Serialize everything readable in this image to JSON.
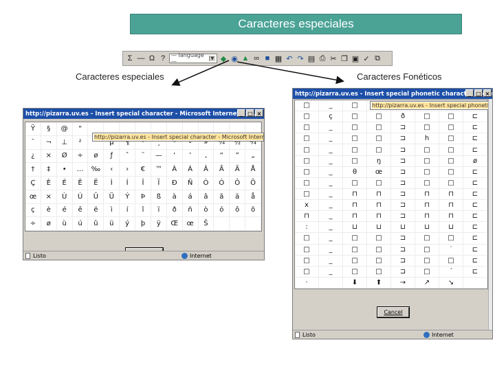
{
  "slide_title": "Caracteres especiales",
  "captions": {
    "left": "Caracteres especiales",
    "right": "Caracteres Fonéticos"
  },
  "toolbar": {
    "language_select": "— language —",
    "icons": [
      "sigma-icon",
      "horizontal-rule-icon",
      "special-char-icon",
      "help-icon",
      "language-select",
      "insert-icon",
      "globe-icon",
      "image-icon",
      "link-icon",
      "media-icon",
      "table-icon",
      "undo-icon",
      "redo-icon",
      "grid-icon",
      "print-icon",
      "cut-icon",
      "copy-icon",
      "paste-icon",
      "spellcheck-icon",
      "fullscreen-icon"
    ]
  },
  "left_window": {
    "title": "http://pizarra.uv.es - Insert special character - Microsoft Internet Ex...",
    "url_overlay": "http://pizarra.uv.es - Insert special character - Microsoft Internet Exp",
    "rows": [
      [
        "Ÿ",
        "§",
        "@",
        "\"",
        "",
        "",
        "",
        "",
        "",
        "",
        "",
        "",
        "",
        "",
        ""
      ],
      [
        "¯",
        "¬",
        "⊥",
        "²",
        "´",
        "µ",
        "¶",
        "·",
        "¸",
        "¹",
        "º",
        "»",
        "¼",
        "½",
        "¾"
      ],
      [
        "¿",
        "×",
        "Ø",
        "÷",
        "ø",
        "ƒ",
        "ˆ",
        "˜",
        "—",
        "‘",
        "’",
        "‚",
        "“",
        "”",
        "„"
      ],
      [
        "†",
        "‡",
        "•",
        "…",
        "‰",
        "‹",
        "›",
        "€",
        "™",
        "À",
        "Á",
        "Â",
        "Ã",
        "Ä",
        "Å",
        "Æ"
      ],
      [
        "Ç",
        "È",
        "É",
        "Ê",
        "Ë",
        "Ì",
        "Í",
        "Î",
        "Ï",
        "Ð",
        "Ñ",
        "Ò",
        "Ó",
        "Ô",
        "Õ",
        "Ö"
      ],
      [
        "œ",
        "×",
        "Ù",
        "Ú",
        "Û",
        "Ü",
        "Ý",
        "Þ",
        "ß",
        "à",
        "á",
        "â",
        "ã",
        "ä",
        "å",
        "æ"
      ],
      [
        "ç",
        "è",
        "é",
        "ê",
        "ë",
        "ì",
        "í",
        "î",
        "ï",
        "ð",
        "ñ",
        "ò",
        "ó",
        "ô",
        "õ",
        "ö"
      ],
      [
        "÷",
        "ø",
        "ù",
        "ú",
        "û",
        "ü",
        "ý",
        "þ",
        "ÿ",
        "Œ",
        "œ",
        "Š",
        "",
        "",
        "",
        ""
      ]
    ],
    "cancel_label": "Cancel",
    "status_left": "Listo",
    "status_zone": "Internet"
  },
  "right_window": {
    "title": "http://pizarra.uv.es - Insert special phonetic character - Microsoft Int...",
    "url_overlay": "http://pizarra.uv.es - Insert special phonetic character",
    "rows": [
      [
        "□",
        "_",
        "□",
        "",
        "",
        "",
        "",
        "",
        ""
      ],
      [
        "□",
        "ç",
        "□",
        "□",
        "ð",
        "□",
        "□",
        "⊏"
      ],
      [
        "□",
        "_",
        "□",
        "□",
        "⊐",
        "□",
        "□",
        "⊏"
      ],
      [
        "□",
        "_",
        "□",
        "□",
        "⊐",
        "h",
        "□",
        "⊏"
      ],
      [
        "□",
        "_",
        "□",
        "□",
        "⊐",
        "□",
        "□",
        "⊏"
      ],
      [
        "□",
        "_",
        "□",
        "ŋ",
        "⊐",
        "□",
        "□",
        "ø"
      ],
      [
        "□",
        "_",
        "θ",
        "œ",
        "⊐",
        "□",
        "□",
        "⊏"
      ],
      [
        "□",
        "_",
        "□",
        "□",
        "⊐",
        "□",
        "□",
        "⊏"
      ],
      [
        "□",
        "_",
        "⊓",
        "⊓",
        "⊐",
        "⊓",
        "⊓",
        "⊏"
      ],
      [
        "x",
        "_",
        "⊓",
        "⊓",
        "⊐",
        "⊓",
        "⊓",
        "⊏"
      ],
      [
        "⊓",
        "_",
        "⊓",
        "⊓",
        "⊐",
        "⊓",
        "⊓",
        "⊏"
      ],
      [
        ":",
        "_",
        "⊔",
        "⊔",
        "⊔",
        "⊔",
        "⊔",
        "⊏"
      ],
      [
        "□",
        "_",
        "□",
        "□",
        "⊐",
        "□",
        "□",
        "⊏"
      ],
      [
        "□",
        "_",
        "□",
        "□",
        "⊐",
        "□",
        "˙",
        "⊏"
      ],
      [
        "□",
        "_",
        "□",
        "□",
        "⊐",
        "□",
        "□",
        "⊏"
      ],
      [
        "□",
        "_",
        "□",
        "□",
        "⊐",
        "□",
        "´",
        "⊏"
      ],
      [
        "·",
        "",
        "⬇",
        "⬆",
        "→",
        "↗",
        "↘",
        ""
      ]
    ],
    "cancel_label": "Cancel",
    "status_left": "Listo",
    "status_zone": "Internet"
  }
}
